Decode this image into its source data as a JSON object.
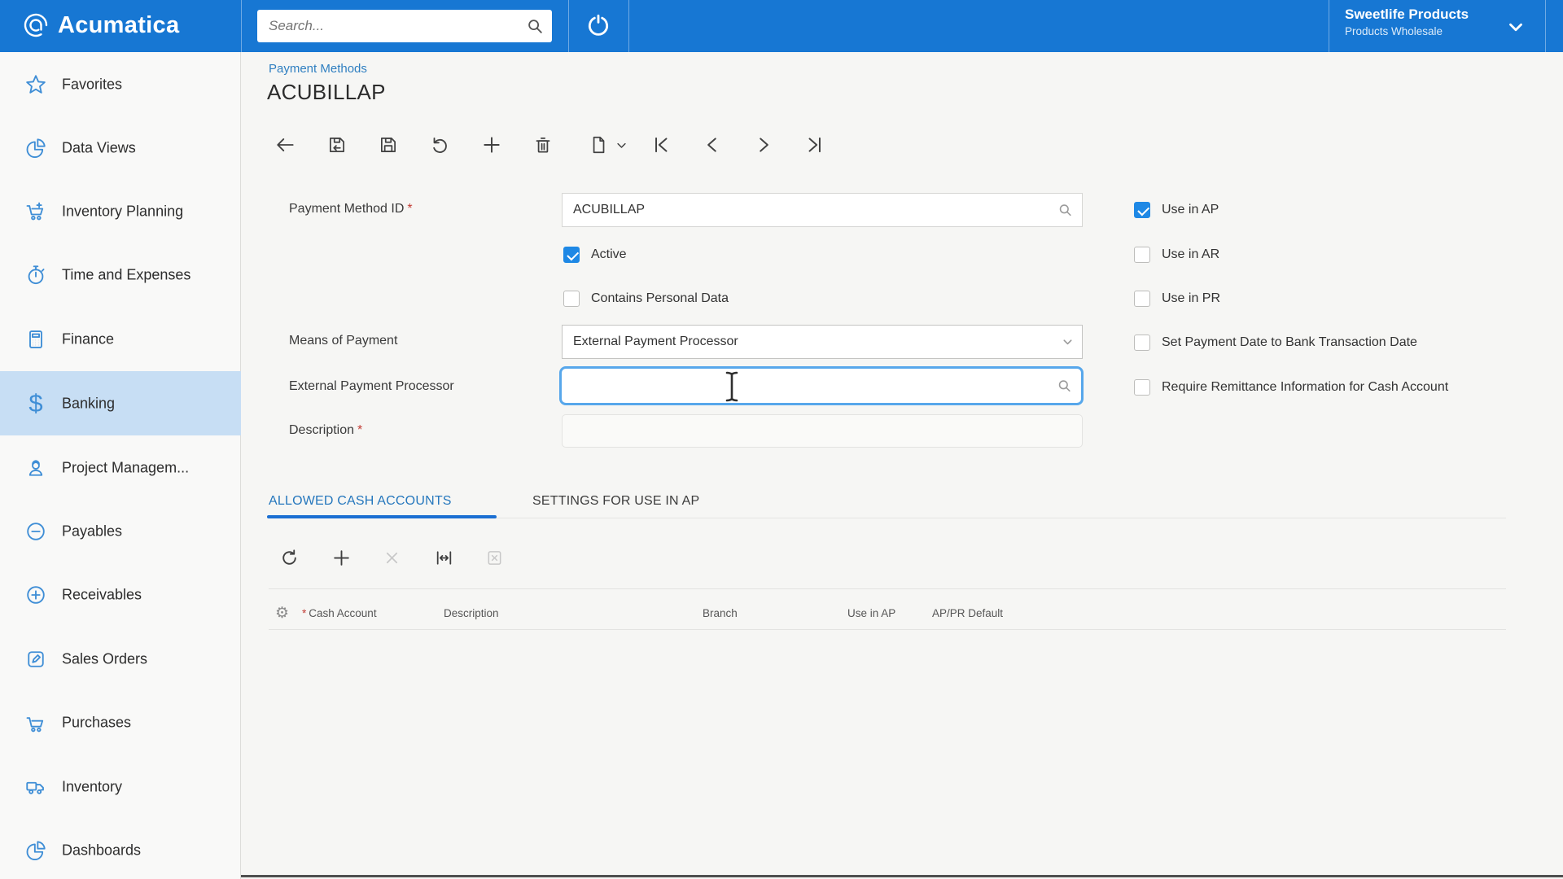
{
  "ui": {
    "required_mark": "*"
  },
  "topbar": {
    "brand": "Acumatica",
    "search_placeholder": "Search...",
    "company_name": "Sweetlife Products",
    "company_branch": "Products Wholesale"
  },
  "sidebar": {
    "items": [
      {
        "label": "Favorites",
        "active": false
      },
      {
        "label": "Data Views",
        "active": false
      },
      {
        "label": "Inventory Planning",
        "active": false
      },
      {
        "label": "Time and Expenses",
        "active": false
      },
      {
        "label": "Finance",
        "active": false
      },
      {
        "label": "Banking",
        "active": true
      },
      {
        "label": "Project Managem...",
        "active": false
      },
      {
        "label": "Payables",
        "active": false
      },
      {
        "label": "Receivables",
        "active": false
      },
      {
        "label": "Sales Orders",
        "active": false
      },
      {
        "label": "Purchases",
        "active": false
      },
      {
        "label": "Inventory",
        "active": false
      },
      {
        "label": "Dashboards",
        "active": false
      }
    ]
  },
  "page": {
    "breadcrumb": "Payment Methods",
    "title": "ACUBILLAP"
  },
  "form": {
    "payment_method_id": {
      "label": "Payment Method ID",
      "value": "ACUBILLAP",
      "required": true
    },
    "active": {
      "label": "Active",
      "checked": true
    },
    "contains_personal_data": {
      "label": "Contains Personal Data",
      "checked": false
    },
    "means_of_payment": {
      "label": "Means of Payment",
      "value": "External Payment Processor"
    },
    "external_payment_processor": {
      "label": "External Payment Processor",
      "value": ""
    },
    "description": {
      "label": "Description",
      "value": "",
      "required": true
    },
    "flags": [
      {
        "label": "Use in AP",
        "checked": true
      },
      {
        "label": "Use in AR",
        "checked": false
      },
      {
        "label": "Use in PR",
        "checked": false
      },
      {
        "label": "Set Payment Date to Bank Transaction Date",
        "checked": false
      },
      {
        "label": "Require Remittance Information for Cash Account",
        "checked": false
      }
    ]
  },
  "tabs": {
    "allowed_cash_accounts": "ALLOWED CASH ACCOUNTS",
    "settings_for_use_in_ap": "SETTINGS FOR USE IN AP"
  },
  "grid": {
    "headers": {
      "cash_account": "Cash Account",
      "description": "Description",
      "branch": "Branch",
      "use_in_ap": "Use in AP",
      "ap_pr_default": "AP/PR Default"
    },
    "rows": []
  }
}
